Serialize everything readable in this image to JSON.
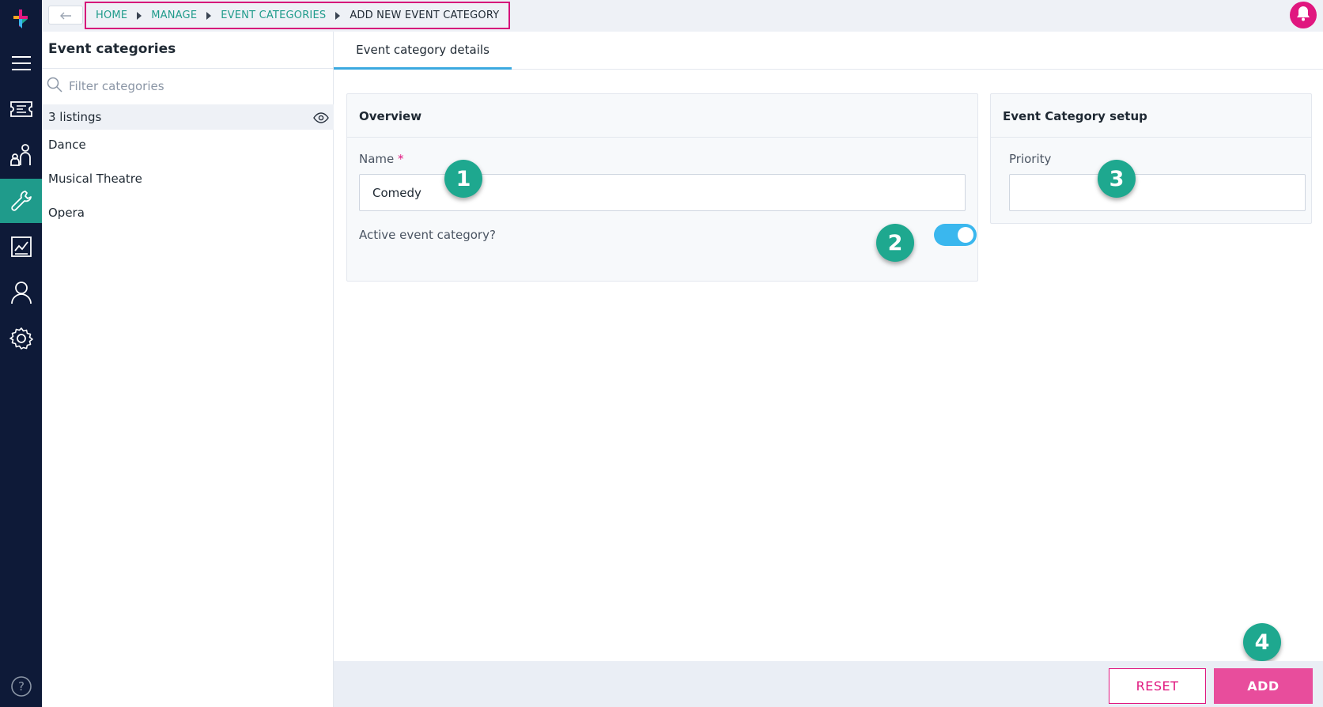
{
  "nav": {
    "items": [
      {
        "icon": "menu-icon"
      },
      {
        "icon": "ticket-icon"
      },
      {
        "icon": "people-icon"
      },
      {
        "icon": "wrench-icon",
        "active": true
      },
      {
        "icon": "report-icon"
      },
      {
        "icon": "user-icon"
      },
      {
        "icon": "gear-icon"
      }
    ],
    "help_icon": "help-icon"
  },
  "breadcrumb": {
    "items": [
      "HOME",
      "MANAGE",
      "EVENT CATEGORIES",
      "ADD NEW EVENT CATEGORY"
    ]
  },
  "sidebar": {
    "title": "Event categories",
    "filter_placeholder": "Filter categories",
    "listings_label": "3 listings",
    "items": [
      "Dance",
      "Musical Theatre",
      "Opera"
    ]
  },
  "tabs": [
    "Event category details"
  ],
  "overview": {
    "title": "Overview",
    "name_label": "Name",
    "name_required": "*",
    "name_value": "Comedy",
    "active_label": "Active event category?",
    "active": true
  },
  "setup": {
    "title": "Event Category setup",
    "priority_label": "Priority",
    "priority_value": ""
  },
  "markers": [
    "1",
    "2",
    "3",
    "4"
  ],
  "actions": {
    "reset": "RESET",
    "add": "ADD"
  },
  "colors": {
    "accent": "#1f9b8b",
    "brand_pink": "#e0177f",
    "toggle_on": "#3ab7ee",
    "marker": "#1ea88f"
  }
}
